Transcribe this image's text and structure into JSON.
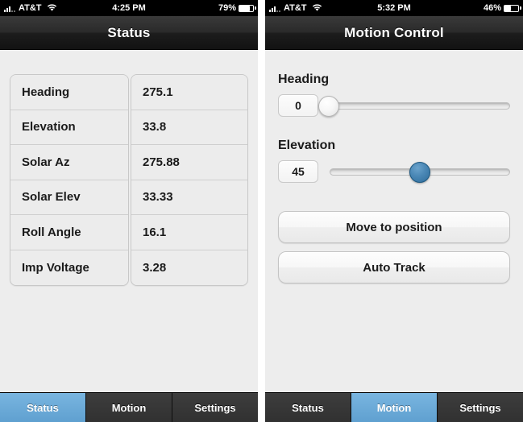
{
  "screens": [
    {
      "id": "status-screen",
      "statusbar": {
        "carrier": "AT&T",
        "time": "4:25 PM",
        "battery_percent": "79%",
        "battery_level": 79,
        "signal_icon": "signal-bars-icon",
        "wifi_icon": "wifi-icon",
        "battery_icon": "battery-icon"
      },
      "navbar": {
        "title": "Status"
      },
      "table": {
        "rows": [
          {
            "label": "Heading",
            "value": "275.1"
          },
          {
            "label": "Elevation",
            "value": "33.8"
          },
          {
            "label": "Solar Az",
            "value": "275.88"
          },
          {
            "label": "Solar Elev",
            "value": "33.33"
          },
          {
            "label": "Roll Angle",
            "value": "16.1"
          },
          {
            "label": "Imp Voltage",
            "value": "3.28"
          }
        ]
      },
      "tabs": [
        {
          "label": "Status",
          "active": true
        },
        {
          "label": "Motion",
          "active": false
        },
        {
          "label": "Settings",
          "active": false
        }
      ]
    },
    {
      "id": "motion-control-screen",
      "statusbar": {
        "carrier": "AT&T",
        "time": "5:32 PM",
        "battery_percent": "46%",
        "battery_level": 46,
        "signal_icon": "signal-bars-icon",
        "wifi_icon": "wifi-icon",
        "battery_icon": "battery-icon"
      },
      "navbar": {
        "title": "Motion Control"
      },
      "controls": {
        "heading": {
          "label": "Heading",
          "value": "0",
          "slider_percent": 0,
          "thumb_color": "#f0f0f0"
        },
        "elevation": {
          "label": "Elevation",
          "value": "45",
          "slider_percent": 50,
          "thumb_color": "#3f7eab"
        },
        "buttons": [
          {
            "label": "Move to position"
          },
          {
            "label": "Auto Track"
          }
        ]
      },
      "tabs": [
        {
          "label": "Status",
          "active": false
        },
        {
          "label": "Motion",
          "active": true
        },
        {
          "label": "Settings",
          "active": false
        }
      ]
    }
  ],
  "colors": {
    "accent": "#5fa0d0",
    "tab_bar": "#313131",
    "nav_bar": "#222222",
    "content_bg": "#ededed"
  }
}
